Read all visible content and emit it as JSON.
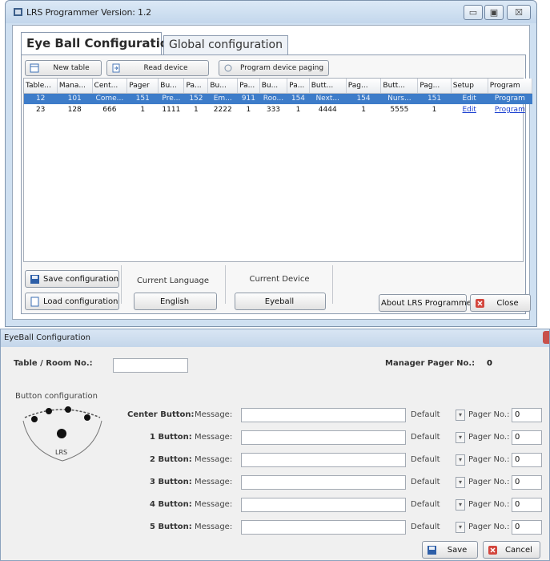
{
  "window": {
    "title": "LRS Programmer  Version: 1.2",
    "minimize": "▭",
    "maximize": "▣",
    "close": "☒"
  },
  "tabs": [
    {
      "label": "Eye Ball Configuration"
    },
    {
      "label": "Global configuration"
    }
  ],
  "toolbar": {
    "new_table": "New table",
    "read_device": "Read device",
    "program_paging": "Program device paging"
  },
  "grid": {
    "columns": [
      "Table...",
      "Mana...",
      "Cent...",
      "Pager",
      "Bu...",
      "Pa...",
      "Bu...",
      "Pa...",
      "Bu...",
      "Pa...",
      "Butt...",
      "Pag...",
      "Butt...",
      "Pag...",
      "Setup",
      "Program"
    ],
    "rows": [
      [
        "12",
        "101",
        "Come...",
        "151",
        "Pre...",
        "152",
        "Em...",
        "911",
        "Roo...",
        "154",
        "Next...",
        "154",
        "Nurs...",
        "151",
        "Edit",
        "Program"
      ],
      [
        "23",
        "128",
        "666",
        "1",
        "1111",
        "1",
        "2222",
        "1",
        "333",
        "1",
        "4444",
        "1",
        "5555",
        "1",
        "Edit",
        "Program"
      ]
    ]
  },
  "bottom": {
    "save_config": "Save configuration",
    "load_config": "Load configuration",
    "current_language_label": "Current Language",
    "language_value": "English",
    "current_device_label": "Current Device",
    "device_value": "Eyeball",
    "about": "About LRS Programmer",
    "close": "Close"
  },
  "dialog": {
    "title": "EyeBall Configuration",
    "table_room_label": "Table / Room No.:",
    "table_room_value": "",
    "manager_pager_label": "Manager Pager No.:",
    "manager_pager_value": "0",
    "button_config_label": "Button configuration",
    "message_label": "Message:",
    "pager_label": "Pager No.:",
    "default_label": "Default",
    "buttons": [
      {
        "name": "Center Button:",
        "message": "",
        "pager": "0"
      },
      {
        "name": "1 Button:",
        "message": "",
        "pager": "0"
      },
      {
        "name": "2 Button:",
        "message": "",
        "pager": "0"
      },
      {
        "name": "3 Button:",
        "message": "",
        "pager": "0"
      },
      {
        "name": "4 Button:",
        "message": "",
        "pager": "0"
      },
      {
        "name": "5 Button:",
        "message": "",
        "pager": "0"
      }
    ],
    "save": "Save",
    "cancel": "Cancel"
  },
  "colors": {
    "selection": "#3d7cc9",
    "link": "#1a3fd0",
    "title_bar": "#cfe0f1"
  }
}
